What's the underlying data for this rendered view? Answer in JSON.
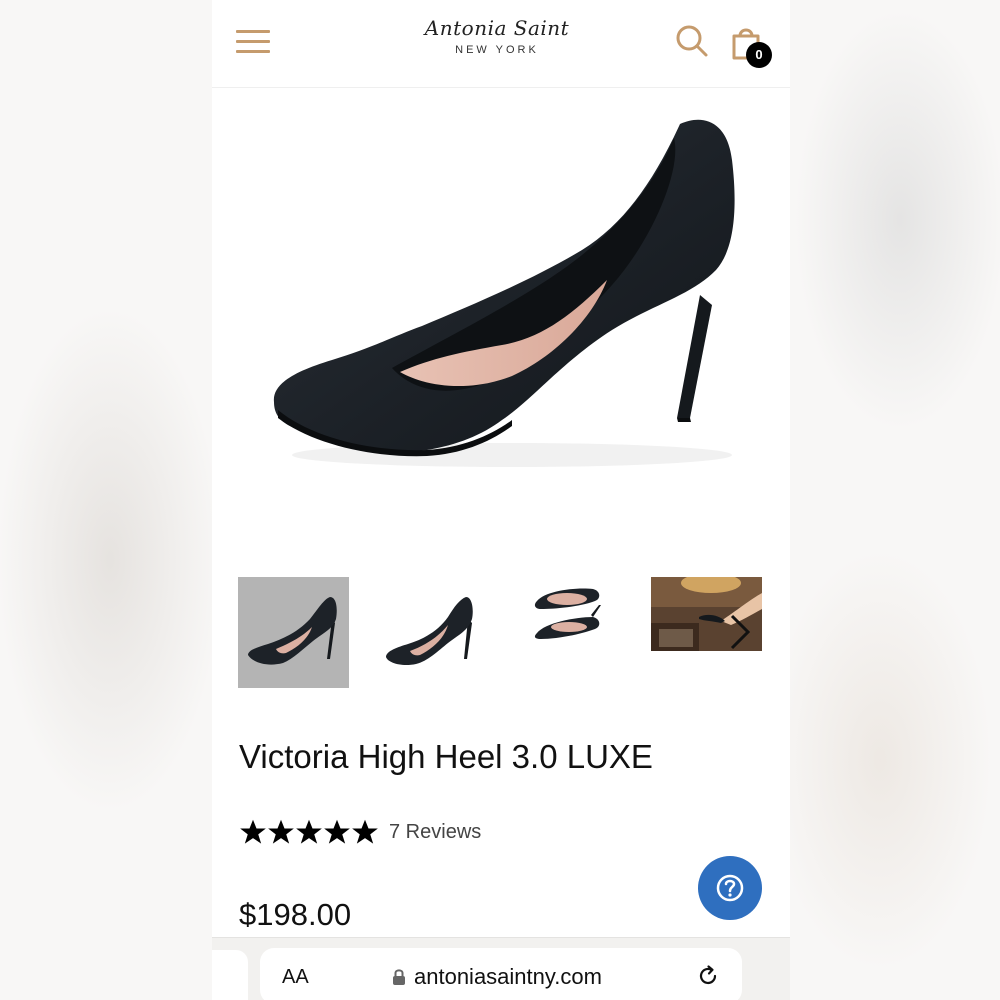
{
  "header": {
    "logo_script": "Antonia Saint",
    "logo_sub": "NEW YORK",
    "cart_count": "0",
    "icons": {
      "menu": "menu-icon",
      "search": "search-icon",
      "cart": "shopping-bag-icon"
    },
    "accent_color": "#c59b6d"
  },
  "gallery": {
    "thumbnails": [
      {
        "name": "thumbnail-side-view",
        "selected": true
      },
      {
        "name": "thumbnail-three-quarter-view",
        "selected": false
      },
      {
        "name": "thumbnail-pair-view",
        "selected": false
      },
      {
        "name": "thumbnail-lifestyle",
        "selected": false
      }
    ],
    "next_icon": "chevron-right-icon"
  },
  "product": {
    "title": "Victoria High Heel 3.0 LUXE",
    "rating": 5,
    "rating_max": 5,
    "reviews_label": "7 Reviews",
    "price": "$198.00"
  },
  "help": {
    "icon": "question-mark-icon",
    "color": "#2f6fbf"
  },
  "browser": {
    "text_size_label": "AA",
    "url": "antoniasaintny.com",
    "icons": {
      "lock": "lock-icon",
      "reload": "reload-icon"
    }
  }
}
